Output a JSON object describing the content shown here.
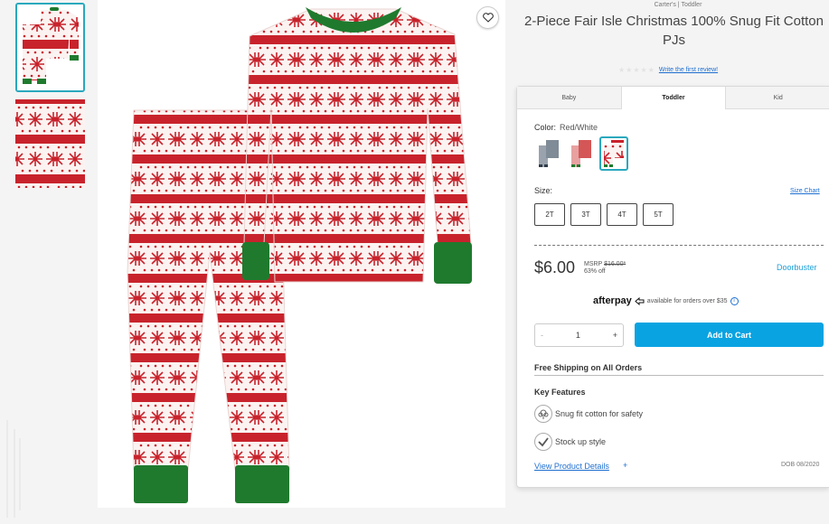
{
  "gallery": {
    "thumbnails": [
      {
        "label": "pajama-set-front",
        "selected": true
      },
      {
        "label": "fabric-pattern-detail",
        "selected": false
      }
    ],
    "favorite_icon": "heart-icon"
  },
  "product": {
    "brand_line": "Carter's | Toddler",
    "title": "2-Piece Fair Isle Christmas 100% Snug Fit Cotton\nPJs",
    "review_link": "Write the first review!",
    "rating_stars": 0
  },
  "tabs": [
    {
      "label": "Baby",
      "active": false
    },
    {
      "label": "Toddler",
      "active": true
    },
    {
      "label": "Kid",
      "active": false
    }
  ],
  "color": {
    "label": "Color:",
    "value": "Red/White",
    "options": [
      {
        "name": "gray-pattern",
        "selected": false
      },
      {
        "name": "red-green-pattern",
        "selected": false
      },
      {
        "name": "red-white-pattern",
        "selected": true
      }
    ]
  },
  "size": {
    "label": "Size:",
    "chart_link": "Size Chart",
    "options": [
      "2T",
      "3T",
      "4T",
      "5T"
    ]
  },
  "pricing": {
    "price": "$6.00",
    "msrp_label": "MSRP",
    "msrp_value": "$16.00*",
    "discount": "63% off",
    "badge": "Doorbuster"
  },
  "afterpay": {
    "logo": "afterpay",
    "text": "available for orders over $35",
    "info_icon": "info-icon"
  },
  "cart": {
    "minus": "-",
    "quantity": "1",
    "plus": "+",
    "add_label": "Add to Cart"
  },
  "shipping": "Free Shipping on All Orders",
  "features": {
    "heading": "Key Features",
    "items": [
      {
        "icon": "cotton-icon",
        "label": "Snug fit cotton for safety"
      },
      {
        "icon": "checkmark-icon",
        "label": "Stock up style"
      }
    ]
  },
  "details": {
    "view_link": "View Product Details",
    "plus": "+",
    "dob": "DOB 08/2020"
  },
  "colors": {
    "accent_blue": "#0aa3e2",
    "selected_border": "#2aa8bd",
    "pattern_red": "#c8232c",
    "cuff_green": "#1f7a2e"
  }
}
